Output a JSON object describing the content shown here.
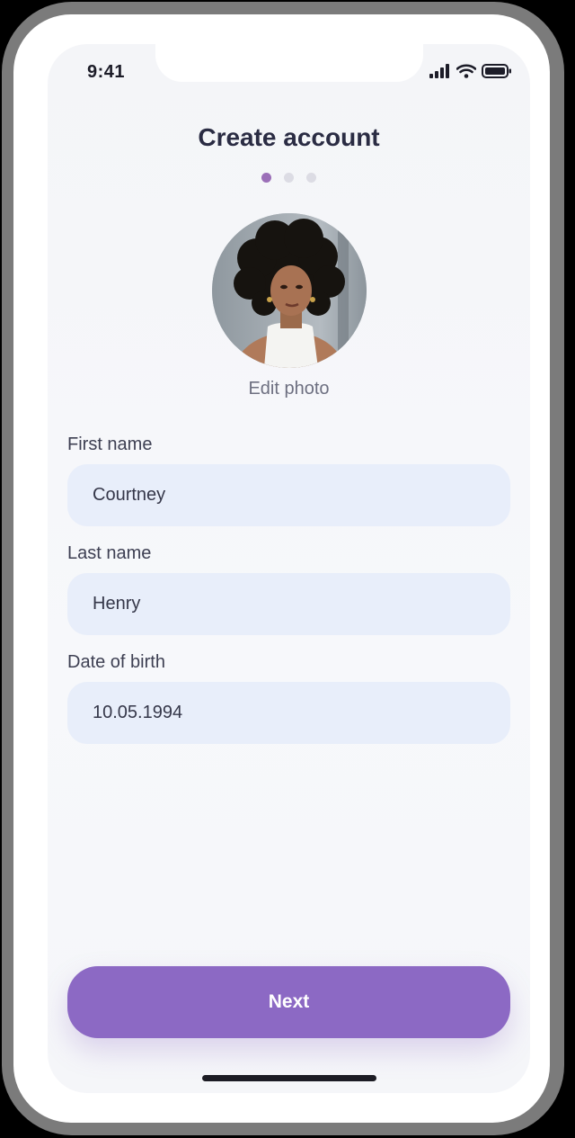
{
  "status_bar": {
    "time": "9:41",
    "icons": [
      "signal-icon",
      "wifi-icon",
      "battery-icon"
    ]
  },
  "header": {
    "title": "Create account"
  },
  "stepper": {
    "total_steps": 3,
    "current_step": 1
  },
  "profile": {
    "avatar": "profile-photo",
    "edit_label": "Edit photo"
  },
  "form": {
    "first_name": {
      "label": "First name",
      "value": "Courtney"
    },
    "last_name": {
      "label": "Last name",
      "value": "Henry"
    },
    "dob": {
      "label": "Date of birth",
      "value": "10.05.1994"
    }
  },
  "actions": {
    "next_label": "Next"
  },
  "colors": {
    "accent": "#8c69c4",
    "active_dot": "#9b6fb8",
    "field_bg": "#e8eefa",
    "title_text": "#2a2c43"
  }
}
